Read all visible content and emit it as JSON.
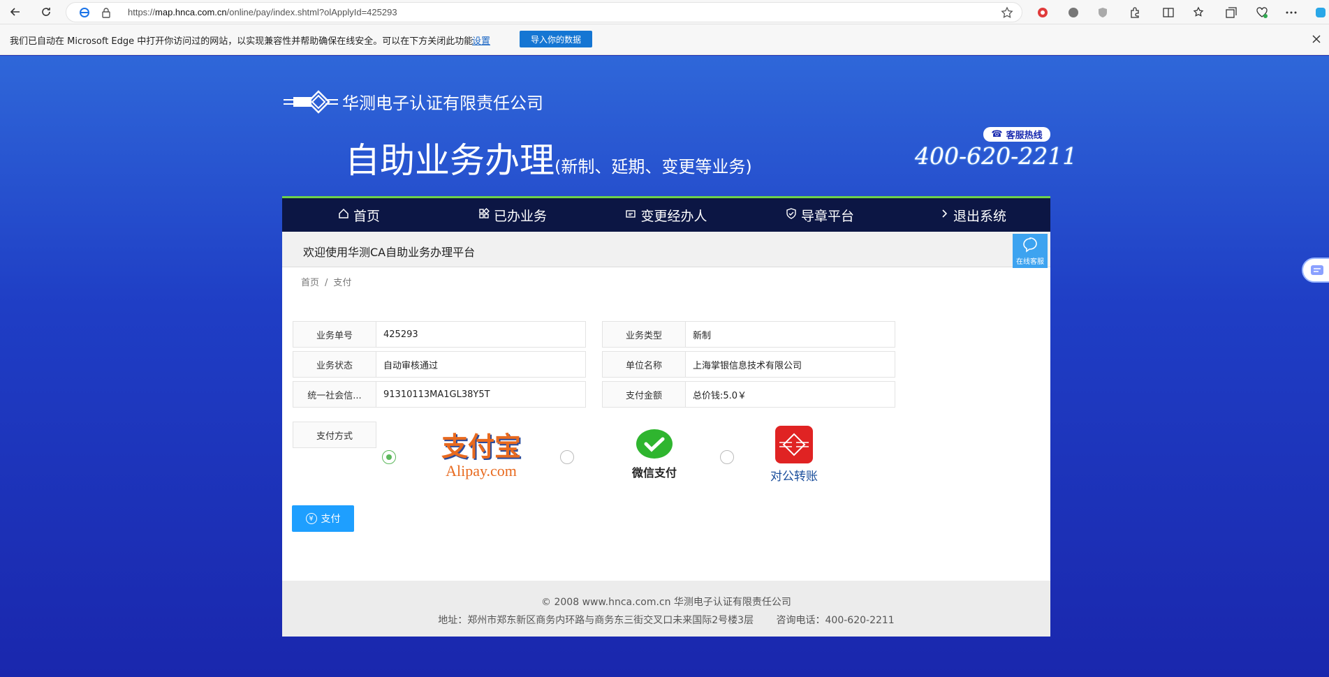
{
  "browser": {
    "url_prefix": "https://",
    "url_host": "map.hnca.com.cn",
    "url_path": "/online/pay/index.shtml?olApplyId=425293"
  },
  "infobar": {
    "message": "我们已自动在 Microsoft Edge 中打开你访问过的网站，以实现兼容性并帮助确保在线安全。可以在下方关闭此功能",
    "settings_link": "设置",
    "import_button": "导入你的数据"
  },
  "header": {
    "company": "华测电子认证有限责任公司",
    "title": "自助业务办理",
    "subtitle": "(新制、延期、变更等业务)",
    "hotline_label": "客服热线",
    "hotline_number": "400-620-2211"
  },
  "nav": [
    {
      "label": "首页",
      "icon": "home-icon"
    },
    {
      "label": "已办业务",
      "icon": "apps-icon"
    },
    {
      "label": "变更经办人",
      "icon": "id-card-icon"
    },
    {
      "label": "导章平台",
      "icon": "shield-icon"
    },
    {
      "label": "退出系统",
      "icon": "chevron-right-icon"
    }
  ],
  "welcome": "欢迎使用华测CA自助业务办理平台",
  "kefu_label": "在线客服",
  "breadcrumb": {
    "home": "首页",
    "sep": "/",
    "current": "支付"
  },
  "form": {
    "order_no_label": "业务单号",
    "order_no": "425293",
    "biz_type_label": "业务类型",
    "biz_type": "新制",
    "status_label": "业务状态",
    "status": "自动审核通过",
    "company_label": "单位名称",
    "company": "上海掌银信息技术有限公司",
    "credit_label": "统一社会信...",
    "credit": "91310113MA1GL38Y5T",
    "amount_label": "支付金额",
    "amount": "总价钱:5.0￥"
  },
  "payment": {
    "label": "支付方式",
    "alipay_cn": "支付宝",
    "alipay_en": "Alipay.com",
    "wechat": "微信支付",
    "transfer": "对公转账",
    "selected": "alipay"
  },
  "pay_button": "支付",
  "footer": {
    "copyright": "© 2008 www.hnca.com.cn 华测电子认证有限责任公司",
    "address": "地址：郑州市郑东新区商务内环路与商务东三街交叉口未来国际2号楼3层　　 咨询电话：400-620-2211"
  },
  "colors": {
    "nav_bg": "#0c1644",
    "nav_border": "#6ed24b",
    "pay_button": "#1e9fff",
    "page_bg": "#1a2bb0"
  }
}
